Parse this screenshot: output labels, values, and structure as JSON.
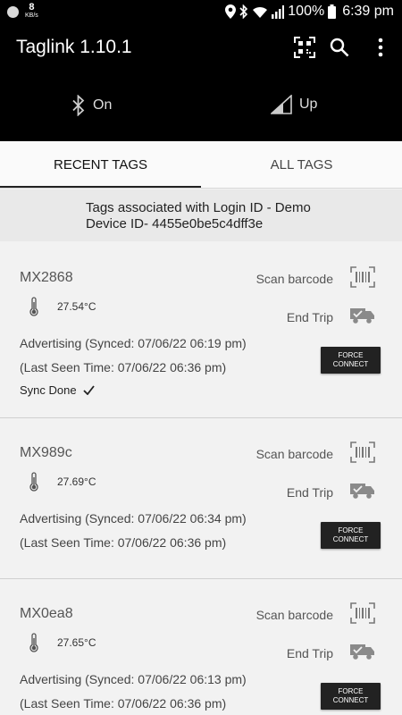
{
  "status_bar": {
    "net_speed_value": "8",
    "net_speed_unit": "KB/s",
    "battery": "100%",
    "time": "6:39 pm"
  },
  "app_bar": {
    "title": "Taglink 1.10.1",
    "icons": [
      "qr-code-icon",
      "search-icon",
      "more-vert-icon"
    ]
  },
  "connection": {
    "bluetooth_label": "On",
    "cellular_label": "Up"
  },
  "tabs": [
    {
      "label": "RECENT TAGS",
      "active": true
    },
    {
      "label": "ALL TAGS",
      "active": false
    }
  ],
  "login_info": {
    "line1": "Tags associated with Login ID - Demo",
    "line2": "Device ID- 4455e0be5c4dff3e"
  },
  "tags": [
    {
      "name": "MX2868",
      "temperature": "27.54°C",
      "advertising": "Advertising (Synced: 07/06/22 06:19 pm)",
      "last_seen": "(Last Seen Time: 07/06/22 06:36 pm)",
      "sync_status": "Sync Done",
      "scan_label": "Scan barcode",
      "end_trip_label": "End Trip",
      "force_line1": "FORCE",
      "force_line2": "CONNECT"
    },
    {
      "name": "MX989c",
      "temperature": "27.69°C",
      "advertising": "Advertising (Synced: 07/06/22 06:34 pm)",
      "last_seen": "(Last Seen Time: 07/06/22 06:36 pm)",
      "scan_label": "Scan barcode",
      "end_trip_label": "End Trip",
      "force_line1": "FORCE",
      "force_line2": "CONNECT"
    },
    {
      "name": "MX0ea8",
      "temperature": "27.65°C",
      "advertising": "Advertising (Synced: 07/06/22 06:13 pm)",
      "last_seen": "(Last Seen Time: 07/06/22 06:36 pm)",
      "scan_label": "Scan barcode",
      "end_trip_label": "End Trip",
      "force_line1": "FORCE",
      "force_line2": "CONNECT"
    }
  ],
  "colors": {
    "app_bar_bg": "#000000",
    "content_bg": "#f2f2f2",
    "button_bg": "#222222"
  }
}
